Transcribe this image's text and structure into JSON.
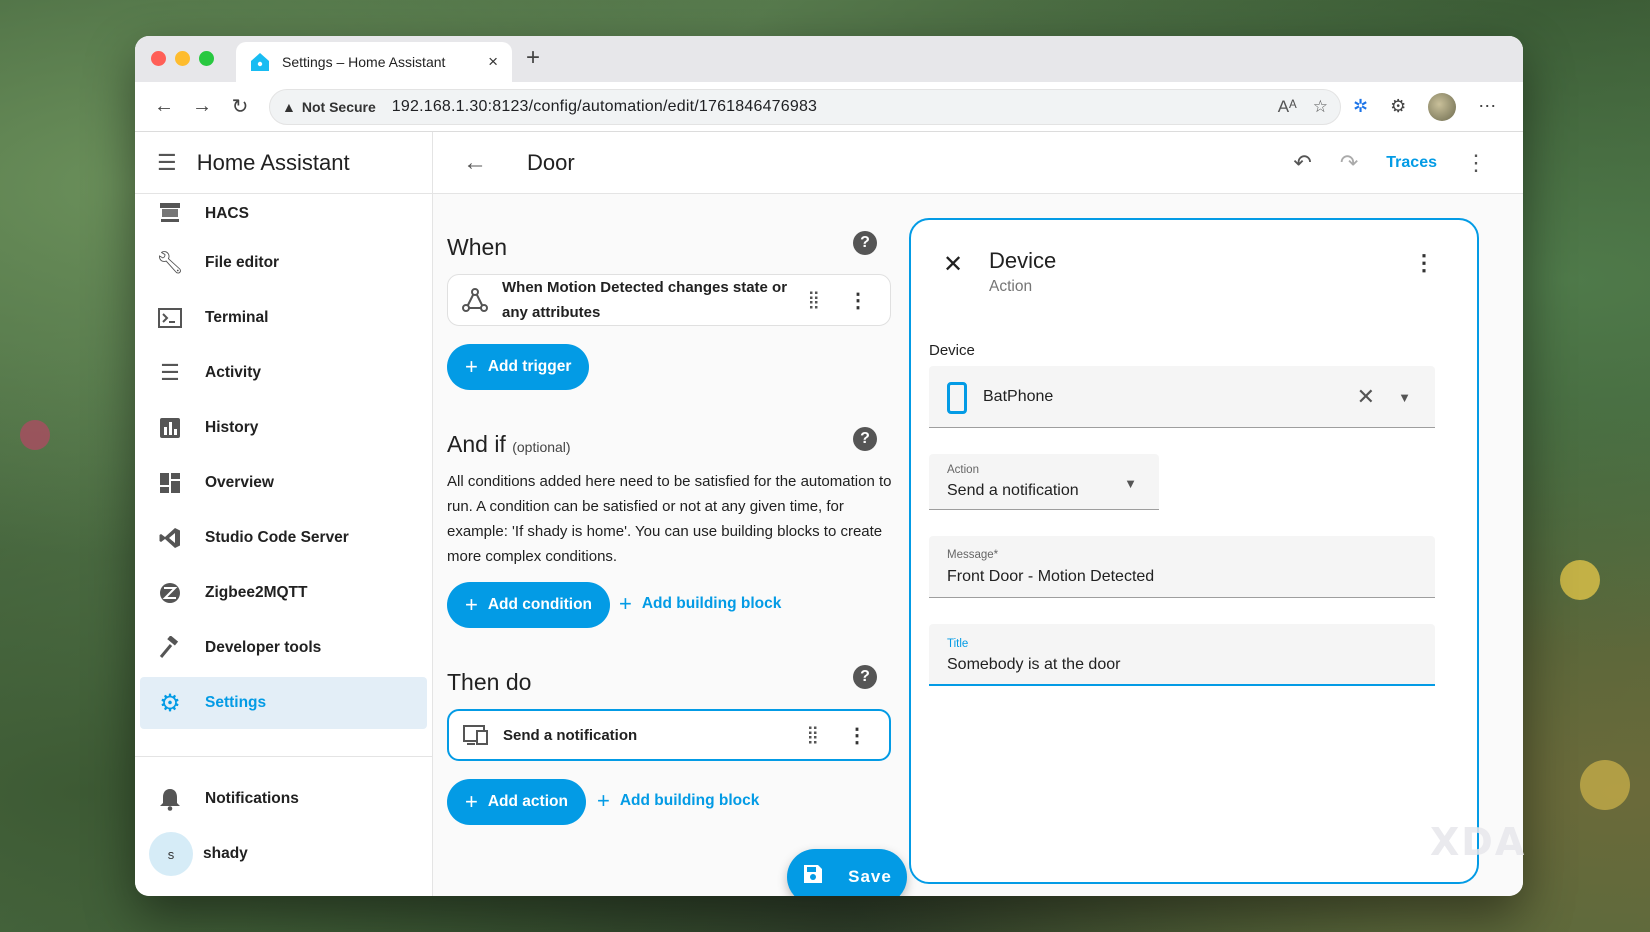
{
  "browser": {
    "tab_title": "Settings – Home Assistant",
    "tab_close": "×",
    "new_tab": "+",
    "security_label": "Not Secure",
    "url": "192.168.1.30:8123/config/automation/edit/1761846476983"
  },
  "colors": {
    "accent": "#039be5",
    "sidebar_active_bg": "#e3eef7"
  },
  "sidebar": {
    "title": "Home Assistant",
    "items": [
      {
        "label": "HACS",
        "icon": "hacs-icon"
      },
      {
        "label": "File editor",
        "icon": "wrench-icon"
      },
      {
        "label": "Terminal",
        "icon": "terminal-icon"
      },
      {
        "label": "Activity",
        "icon": "list-icon"
      },
      {
        "label": "History",
        "icon": "chart-icon"
      },
      {
        "label": "Overview",
        "icon": "dashboard-icon"
      },
      {
        "label": "Studio Code Server",
        "icon": "vscode-icon"
      },
      {
        "label": "Zigbee2MQTT",
        "icon": "zigbee-icon"
      },
      {
        "label": "Developer tools",
        "icon": "hammer-icon"
      },
      {
        "label": "Settings",
        "icon": "gear-icon",
        "active": true
      }
    ],
    "notifications_label": "Notifications",
    "user_name": "shady",
    "user_initial": "s"
  },
  "header": {
    "title": "Door",
    "traces_label": "Traces"
  },
  "editor": {
    "when": {
      "title": "When",
      "trigger_label": "When Motion Detected changes state or any attributes",
      "add_trigger": "Add trigger"
    },
    "and_if": {
      "title": "And if",
      "optional": "(optional)",
      "description": "All conditions added here need to be satisfied for the automation to run. A condition can be satisfied or not at any given time, for example: 'If shady is home'. You can use building blocks to create more complex conditions.",
      "add_condition": "Add condition",
      "add_building_block": "Add building block"
    },
    "then_do": {
      "title": "Then do",
      "action_label": "Send a notification",
      "add_action": "Add action",
      "add_building_block": "Add building block"
    },
    "save_label": "Save"
  },
  "panel": {
    "title": "Device",
    "subtitle": "Action",
    "device_label": "Device",
    "device_value": "BatPhone",
    "action_field_label": "Action",
    "action_field_value": "Send a notification",
    "message_label": "Message*",
    "message_value": "Front Door - Motion Detected",
    "title_label": "Title",
    "title_value": "Somebody is at the door"
  },
  "watermark": "XDA"
}
